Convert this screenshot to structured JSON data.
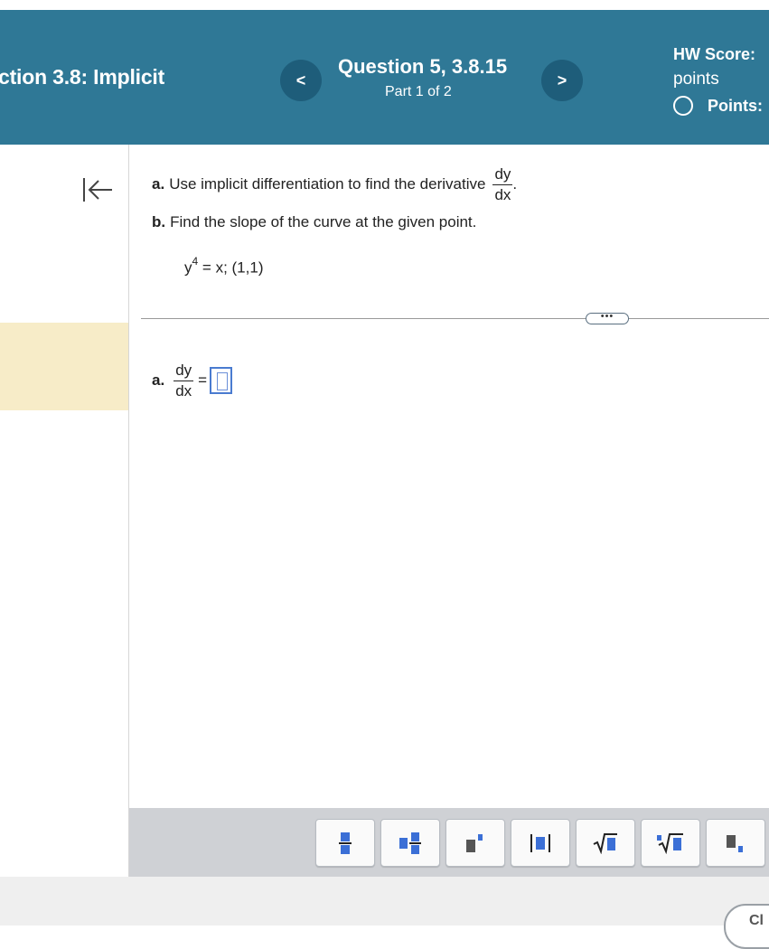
{
  "header": {
    "section_title": "ction 3.8: Implicit",
    "question_title": "Question 5, 3.8.15",
    "part": "Part 1 of 2",
    "prev_label": "<",
    "next_label": ">",
    "hw_score_label": "HW Score:",
    "points_text": "points",
    "points_label": "Points:"
  },
  "problem": {
    "part_a_label": "a.",
    "part_a_text": "Use implicit differentiation to find the derivative",
    "deriv_num": "dy",
    "deriv_den": "dx",
    "period": ".",
    "part_b_label": "b.",
    "part_b_text": "Find the slope of the curve at the given point.",
    "eq_base": "y",
    "eq_exp": "4",
    "eq_rest": "= x; (1,1)"
  },
  "more_label": "•••",
  "answer": {
    "label": "a.",
    "num": "dy",
    "den": "dx",
    "equals": "=",
    "value": ""
  },
  "toolbar": {
    "buttons": [
      "fraction",
      "mixed-number",
      "exponent",
      "absolute-value",
      "square-root",
      "nth-root",
      "subscript"
    ]
  },
  "bottom": {
    "close_label": "Cl"
  },
  "colors": {
    "header": "#2f7896",
    "nav_button": "#1e5d7a",
    "highlight": "#f7ecc8",
    "answer_border": "#4a7bd0",
    "toolbar": "#cfd1d5"
  }
}
